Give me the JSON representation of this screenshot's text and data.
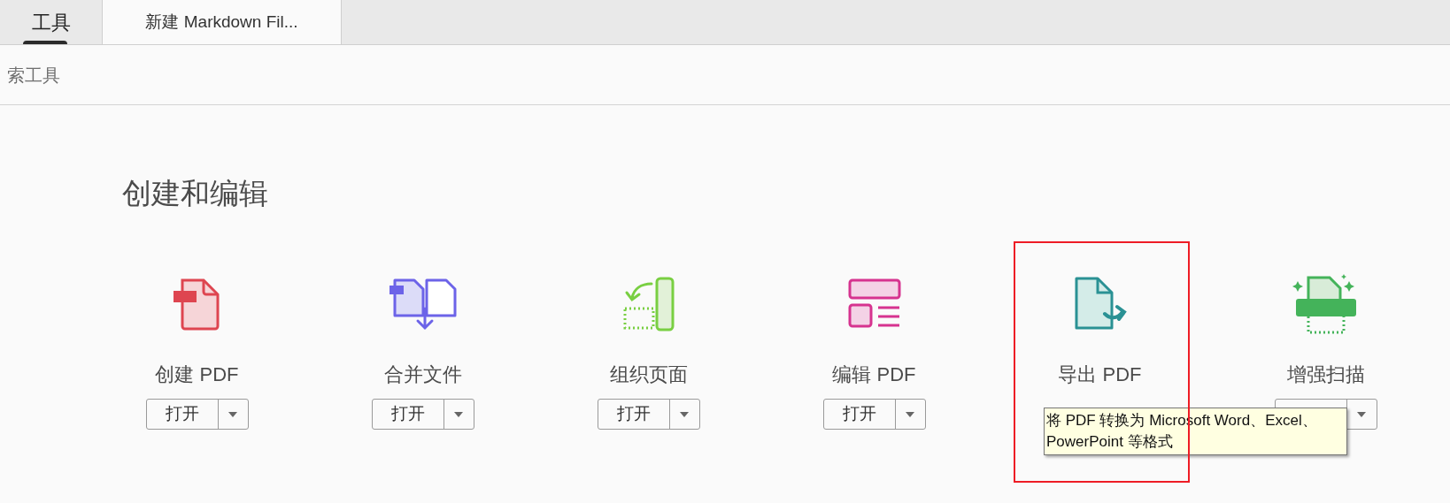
{
  "tabs": [
    {
      "label": "工具",
      "selected": true
    },
    {
      "label": "新建 Markdown Fil...",
      "selected": false
    }
  ],
  "search": {
    "placeholder": "索工具"
  },
  "section": {
    "title": "创建和编辑",
    "tools": [
      {
        "kind": "create",
        "label": "创建 PDF",
        "highlighted": false,
        "button": {
          "label": "打开",
          "menu": true
        }
      },
      {
        "kind": "combine",
        "label": "合并文件",
        "highlighted": false,
        "button": {
          "label": "打开",
          "menu": true
        }
      },
      {
        "kind": "organize",
        "label": "组织页面",
        "highlighted": false,
        "button": {
          "label": "打开",
          "menu": true
        }
      },
      {
        "kind": "edit",
        "label": "编辑 PDF",
        "highlighted": false,
        "button": {
          "label": "打开",
          "menu": true
        }
      },
      {
        "kind": "export",
        "label": "导出 PDF",
        "highlighted": true,
        "tooltip": "将 PDF 转换为 Microsoft Word、Excel、PowerPoint 等格式"
      },
      {
        "kind": "scan",
        "label": "增强扫描",
        "highlighted": false,
        "button": {
          "menu": true
        }
      }
    ]
  }
}
